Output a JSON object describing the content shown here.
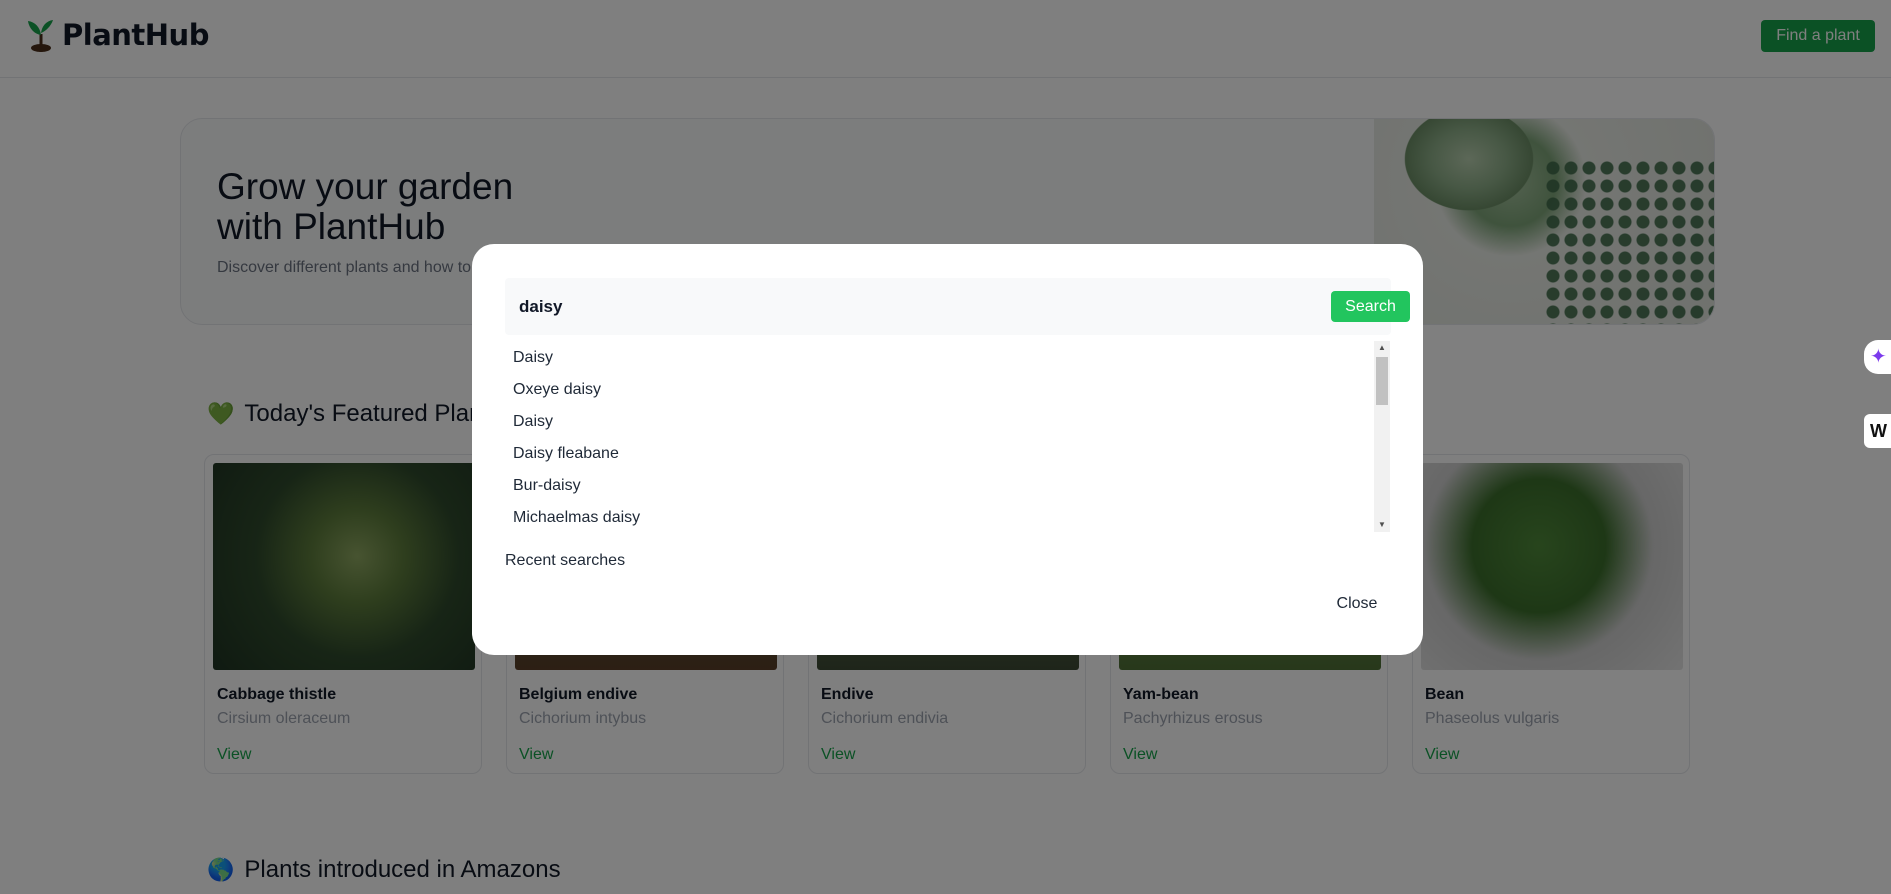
{
  "header": {
    "brand": "PlantHub",
    "find_button": "Find a plant"
  },
  "hero": {
    "title_line1": "Grow your garden",
    "title_line2": "with PlantHub",
    "subtitle": "Discover different plants and how to"
  },
  "featured": {
    "title": "Today's Featured Plants",
    "icon": "green-heart-icon",
    "cards": [
      {
        "name": "Cabbage thistle",
        "scientific": "Cirsium oleraceum",
        "view": "View"
      },
      {
        "name": "Belgium endive",
        "scientific": "Cichorium intybus",
        "view": "View"
      },
      {
        "name": "Endive",
        "scientific": "Cichorium endivia",
        "view": "View"
      },
      {
        "name": "Yam-bean",
        "scientific": "Pachyrhizus erosus",
        "view": "View"
      },
      {
        "name": "Bean",
        "scientific": "Phaseolus vulgaris",
        "view": "View"
      }
    ]
  },
  "amazon": {
    "title": "Plants introduced in Amazons",
    "icon": "globe-icon"
  },
  "modal": {
    "search_value": "daisy",
    "search_button": "Search",
    "results": [
      "Daisy",
      "Oxeye daisy",
      "Daisy",
      "Daisy fleabane",
      "Bur-daisy",
      "Michaelmas daisy"
    ],
    "recent_label": "Recent searches",
    "close_button": "Close"
  },
  "side_widgets": {
    "widget2": "W"
  },
  "colors": {
    "brand_green": "#16a34a",
    "search_green": "#22c55e"
  }
}
